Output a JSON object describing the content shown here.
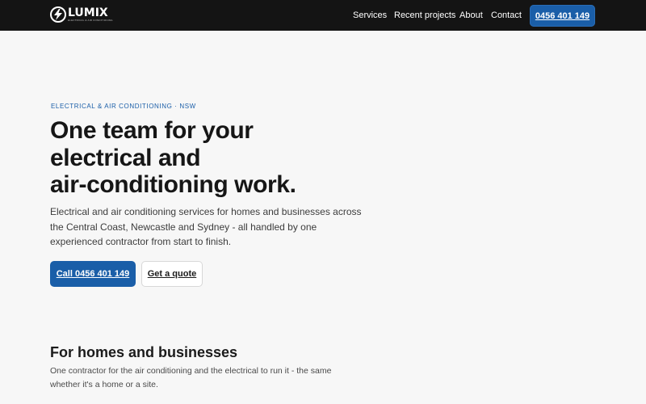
{
  "header": {
    "logo_name": "LUMIX",
    "logo_tagline": "ELECTRICAL & AIR CONDITIONING",
    "nav": [
      "Services",
      "Recent projects",
      "About",
      "Contact"
    ],
    "phone_button": "0456 401 149"
  },
  "hero": {
    "eyebrow": "ELECTRICAL & AIR CONDITIONING · NSW",
    "title_lines": [
      "One team for your",
      "electrical and",
      "air-conditioning work."
    ],
    "description_lines": [
      "Electrical and air conditioning services for homes and businesses across",
      "the Central Coast, Newcastle and Sydney - all handled by one",
      "experienced contractor from start to finish."
    ],
    "cta_primary": "Call 0456 401 149",
    "cta_secondary": "Get a quote"
  },
  "section": {
    "title": "For homes and businesses",
    "description_lines": [
      "One contractor for the air conditioning and the electrical to run it - the same",
      "whether it's a home or a site."
    ]
  },
  "colors": {
    "header_bg": "#141414",
    "accent": "#1a5ea8",
    "page_bg": "#f7f7f7"
  },
  "icons": {
    "logo": "lightning-bolt-icon"
  }
}
